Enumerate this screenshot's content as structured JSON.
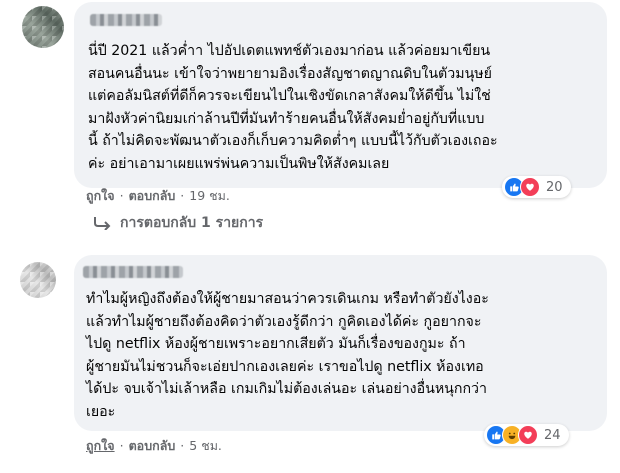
{
  "comments": [
    {
      "author": "",
      "text_lines": [
        "นี่ปี 2021 แล้วค่ำา ไปอัปเดตแพทช์ตัวเองมาก่อน แล้วค่อยมาเขียน",
        "สอนคนอื่นนะ เข้าใจว่าพยายามอิงเรื่องสัญชาตญาณดิบในตัวมนุษย์",
        "แต่คอลัมนิสต์ที่ดีก็ควรจะเขียนไปในเชิงขัดเกลาสังคมให้ดีขึ้น ไม่ใช่",
        "มาฝังหัวค่านิยมเก่าล้านปีที่มันทำร้ายคนอื่นให้สังคมย่ำอยู่กับที่แบบ",
        "นี้ ถ้าไม่คิดจะพัฒนาตัวเองก็เก็บความคิดต่ำๆ แบบนี้ไว้กับตัวเองเถอะ",
        "ค่ะ อย่าเอามาเผยแพร่พ่นความเป็นพิษให้สังคมเลย"
      ],
      "like_label": "ถูกใจ",
      "reply_label": "ตอบกลับ",
      "time": "19 ชม.",
      "reaction_count": "20",
      "reactions": [
        "like",
        "love"
      ]
    },
    {
      "author": "",
      "text_lines": [
        "ทำไมผู้หญิงถึงต้องให้ผู้ชายมาสอนว่าควรเดินเกม หรือทำตัวยังไงอะ",
        "แล้วทำไมผู้ชายถึงต้องคิดว่าตัวเองรู้ดีกว่า กูคิดเองได้ค่ะ กูอยากจะ",
        "ไปดู netflix ห้องผู้ชายเพราะอยากเสียตัว มันก็เรื่องของกูมะ ถ้า",
        "ผู้ชายมันไม่ชวนก็จะเอ่ยปากเองเลยค่ะ เราขอไปดู netflix ห้องเทอ",
        "ได้ปะ จบเจ้าไม่เล้าหลือ เกมเกิมไม่ต้องเล่นอะ เล่นอย่างอื่นหนุกกว่า",
        "เยอะ"
      ],
      "like_label": "ถูกใจ",
      "reply_label": "ตอบกลับ",
      "time": "5 ชม.",
      "reaction_count": "24",
      "reactions": [
        "like",
        "haha",
        "love"
      ]
    }
  ],
  "replies_link": "การตอบกลับ 1 รายการ",
  "colors": {
    "bubble": "#f0f2f5",
    "secondary_text": "#65676b",
    "like": "#1877f2",
    "love": "#f33e58",
    "haha": "#f7b125"
  },
  "icons": [
    "like-icon",
    "love-icon",
    "haha-icon",
    "reply-arrow-icon"
  ]
}
